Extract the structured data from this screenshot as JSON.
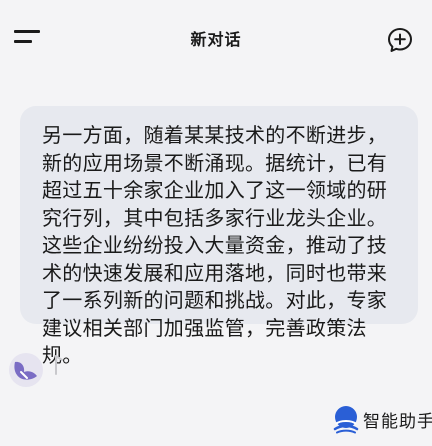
{
  "header": {
    "title": "新对话",
    "menu_icon": "menu-icon",
    "new_chat_icon": "new-chat-icon"
  },
  "message": {
    "text": "另一方面，随着某某技术的不断进步，新的应用场景不断涌现。据统计，已有超过五十余家企业加入了这一领域的研究行列，其中包括多家行业龙头企业。这些企业纷纷投入大量资金，推动了技术的快速发展和应用落地，同时也带来了一系列新的问题和挑战。对此，专家建议相关部门加强监管，完善政策法规。"
  },
  "footer": {
    "avatar_icon": "assistant-avatar-icon",
    "feedback_icon": "thumb-icon"
  },
  "brand": {
    "name": "智能助手",
    "logo_icon": "brand-logo-icon"
  },
  "colors": {
    "background": "#f4f4f6",
    "bubble": "#e7e9ef",
    "brand_blue": "#2a5fd6",
    "avatar_purple": "#7a6cc4"
  }
}
